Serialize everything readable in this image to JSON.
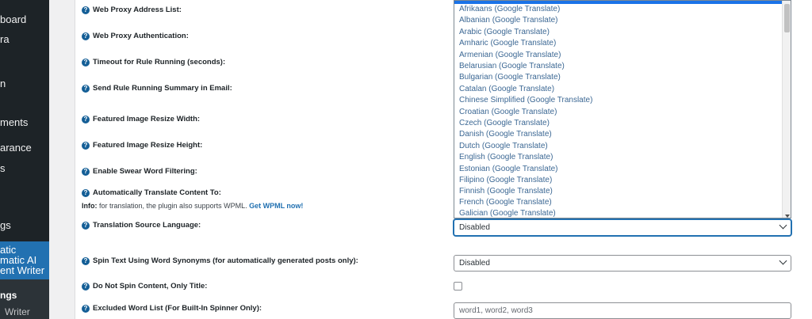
{
  "sidebar": {
    "items": [
      {
        "label": "board"
      },
      {
        "label": "ra"
      },
      {
        "label": "n"
      },
      {
        "label": "ments"
      },
      {
        "label": "arance"
      },
      {
        "label": "s"
      },
      {
        "label": "gs"
      }
    ],
    "active": {
      "line1": "atic",
      "line2": "matic AI",
      "line3": "ent Writer"
    },
    "submenu": [
      {
        "label": "ngs"
      },
      {
        "label": "Writer"
      }
    ]
  },
  "settings": {
    "rows": [
      {
        "label": "Web Proxy Address List:"
      },
      {
        "label": "Web Proxy Authentication:"
      },
      {
        "label": "Timeout for Rule Running (seconds):"
      },
      {
        "label": "Send Rule Running Summary in Email:"
      },
      {
        "label": "Featured Image Resize Width:"
      },
      {
        "label": "Featured Image Resize Height:"
      },
      {
        "label": "Enable Swear Word Filtering:"
      },
      {
        "label": "Automatically Translate Content To:"
      },
      {
        "label": "Translation Source Language:"
      },
      {
        "label": "Spin Text Using Word Synonyms (for automatically generated posts only):"
      },
      {
        "label": "Do Not Spin Content, Only Title:"
      },
      {
        "label": "Excluded Word List (For Built-In Spinner Only):"
      }
    ],
    "info": {
      "prefix": "Info:",
      "text": " for translation, the plugin also supports WPML. ",
      "link": "Get WPML now!"
    },
    "translation_source_value": "Disabled",
    "spin_text_value": "Disabled",
    "excluded_words_placeholder": "word1, word2, word3"
  },
  "dropdown": {
    "options": [
      "Afrikaans (Google Translate)",
      "Albanian (Google Translate)",
      "Arabic (Google Translate)",
      "Amharic (Google Translate)",
      "Armenian (Google Translate)",
      "Belarusian (Google Translate)",
      "Bulgarian (Google Translate)",
      "Catalan (Google Translate)",
      "Chinese Simplified (Google Translate)",
      "Croatian (Google Translate)",
      "Czech (Google Translate)",
      "Danish (Google Translate)",
      "Dutch (Google Translate)",
      "English (Google Translate)",
      "Estonian (Google Translate)",
      "Filipino (Google Translate)",
      "Finnish (Google Translate)",
      "French (Google Translate)",
      "Galician (Google Translate)"
    ]
  },
  "colors": {
    "sidebar_bg": "#1d2327",
    "accent": "#2271b1",
    "help_icon": "#135e96"
  }
}
